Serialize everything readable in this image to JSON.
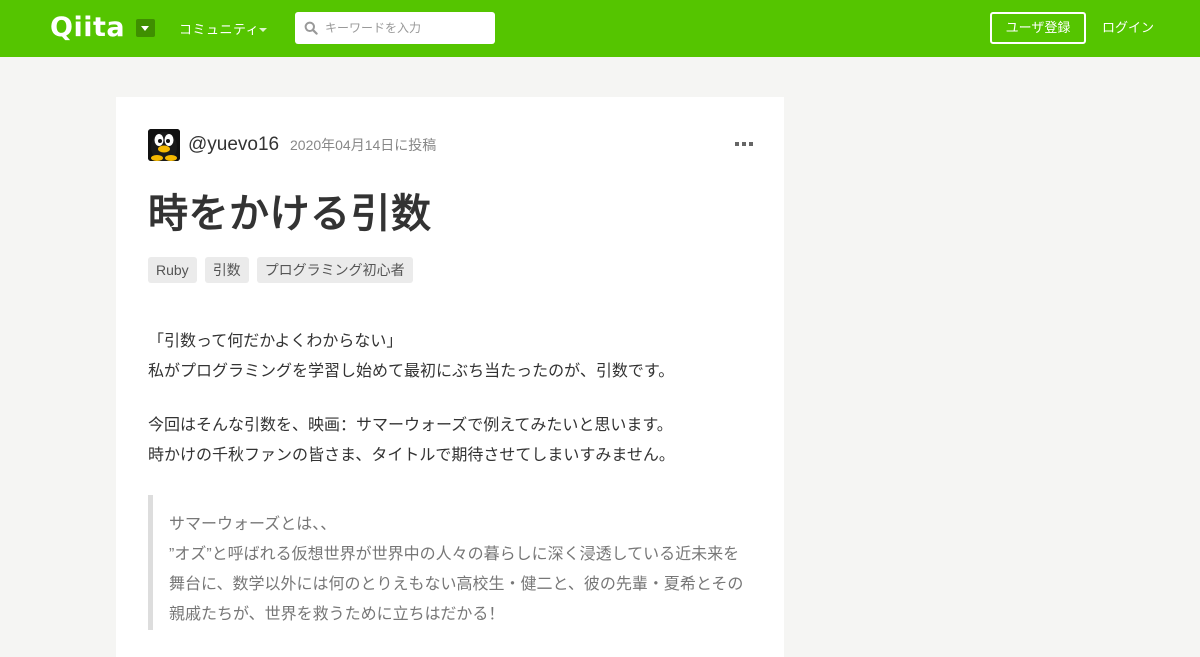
{
  "header": {
    "logo": "Qiita",
    "community_label": "コミュニティ",
    "search_placeholder": "キーワードを入力",
    "signup_label": "ユーザ登録",
    "login_label": "ログイン",
    "brand_color": "#55c500"
  },
  "article": {
    "username": "@yuevo16",
    "posted_date": "2020年04月14日に投稿",
    "title": "時をかける引数",
    "tags": [
      "Ruby",
      "引数",
      "プログラミング初心者"
    ],
    "paragraphs": [
      [
        "「引数って何だかよくわからない」",
        "私がプログラミングを学習し始めて最初にぶち当たったのが、引数です。"
      ],
      [
        "今回はそんな引数を、映画：サマーウォーズで例えてみたいと思います。",
        "時かけの千秋ファンの皆さま、タイトルで期待させてしまいすみません。"
      ]
    ],
    "quote_lines": [
      "サマーウォーズとは、、",
      "”オズ”と呼ばれる仮想世界が世界中の人々の暮らしに深く浸透している近未来を",
      "舞台に、数学以外には何のとりえもない高校生・健二と、彼の先輩・夏希とその",
      "親戚たちが、世界を救うために立ちはだかる！"
    ]
  },
  "icons": {
    "search": "search-icon",
    "more": "more-icon",
    "dropdown": "chevron-down-icon",
    "avatar": "penguin-avatar"
  }
}
